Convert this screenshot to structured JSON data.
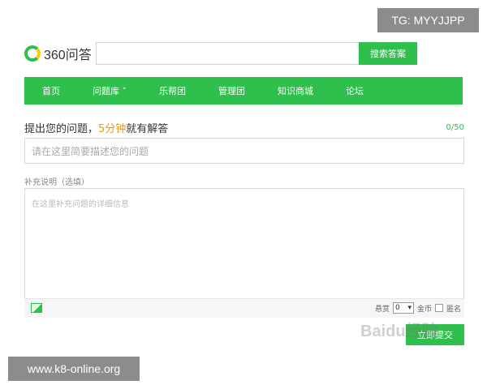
{
  "header": {
    "logo_text": "360问答",
    "search_placeholder": "",
    "search_button": "搜索答案"
  },
  "nav": {
    "items": [
      "首页",
      "问题库 ˅",
      "乐帮团",
      "管理团",
      "知识商城",
      "论坛"
    ]
  },
  "ask": {
    "title_prefix": "提出您的问题，",
    "title_highlight": "5分钟",
    "title_suffix": "就有解答",
    "counter": "0/50",
    "question_placeholder": "请在这里简要描述您的问题",
    "supplement_label": "补充说明（选填）",
    "supplement_placeholder": "在这里补充问题的详细信息"
  },
  "toolbar": {
    "reward_label": "悬赏",
    "reward_value": "0",
    "currency": "金币",
    "anonymous_label": "匿名"
  },
  "submit_label": "立即提交",
  "watermarks": {
    "tg": "TG: MYYJJPP",
    "url": "www.k8-online.org",
    "baidu": "Baidu经验"
  },
  "colors": {
    "brand_green": "#2fbf4c",
    "highlight_orange": "#f39800"
  }
}
